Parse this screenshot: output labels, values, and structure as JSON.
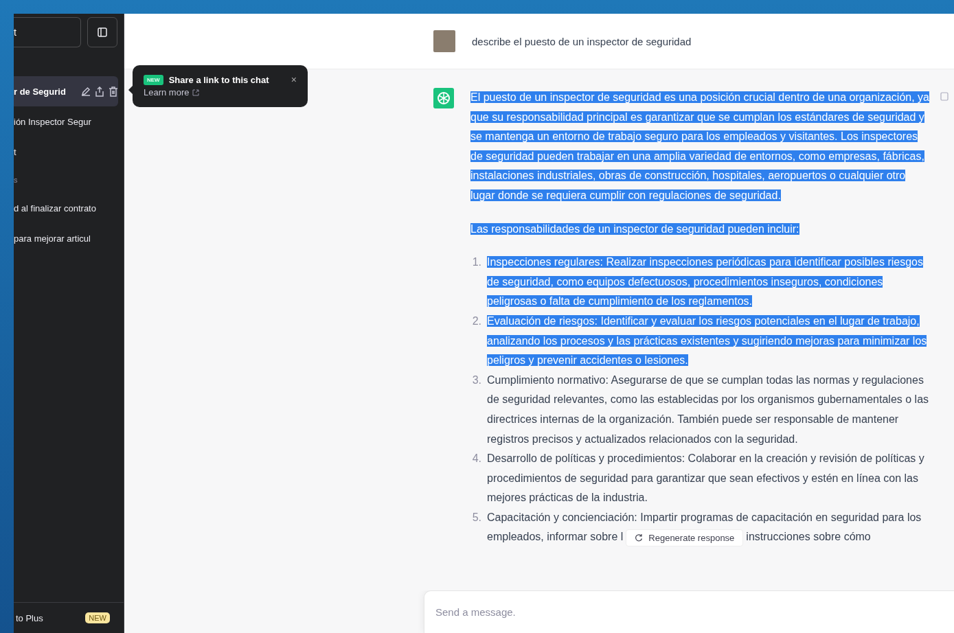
{
  "sidebar": {
    "new_chat_label": "t",
    "chats": [
      {
        "kind": "chat",
        "title": "r de Segurid",
        "selected": true
      },
      {
        "kind": "chat",
        "title": "ión Inspector Segur",
        "selected": false
      },
      {
        "kind": "chat",
        "title": "t",
        "selected": false
      },
      {
        "kind": "heading",
        "title": "s"
      },
      {
        "kind": "chat",
        "title": "d al finalizar contrato",
        "selected": false
      },
      {
        "kind": "chat",
        "title": "para mejorar articul",
        "selected": false
      }
    ],
    "upgrade": {
      "label": "to Plus",
      "badge": "NEW"
    }
  },
  "tooltip": {
    "badge": "NEW",
    "title": "Share a link to this chat",
    "link": "Learn more",
    "close": "×"
  },
  "conversation": {
    "user_message": "describe el puesto de un inspector de seguridad",
    "paragraphs": [
      {
        "text": "El puesto de un inspector de seguridad es una posición crucial dentro de una organización, ya que su responsabilidad principal es garantizar que se cumplan los estándares de seguridad y se mantenga un entorno de trabajo seguro para los empleados y visitantes. Los inspectores de seguridad pueden trabajar en una amplia variedad de entornos, como empresas, fábricas, instalaciones industriales, obras de construcción, hospitales, aeropuertos o cualquier otro lugar donde se requiera cumplir con regulaciones de seguridad.",
        "selected": true
      },
      {
        "text": "Las responsabilidades de un inspector de seguridad pueden incluir:",
        "selected": true
      }
    ],
    "list": [
      {
        "number": "1.",
        "text": "Inspecciones regulares: Realizar inspecciones periódicas para identificar posibles riesgos de seguridad, como equipos defectuosos, procedimientos inseguros, condiciones peligrosas o falta de cumplimiento de los reglamentos.",
        "selected": true
      },
      {
        "number": "2.",
        "text": "Evaluación de riesgos: Identificar y evaluar los riesgos potenciales en el lugar de trabajo, analizando los procesos y las prácticas existentes y sugiriendo mejoras para minimizar los peligros y prevenir accidentes o lesiones.",
        "selected": true
      },
      {
        "number": "3.",
        "text": "Cumplimiento normativo: Asegurarse de que se cumplan todas las normas y regulaciones de seguridad relevantes, como las establecidas por los organismos gubernamentales o las directrices internas de la organización. También puede ser responsable de mantener registros precisos y actualizados relacionados con la seguridad.",
        "selected": false
      },
      {
        "number": "4.",
        "text": "Desarrollo de políticas y procedimientos: Colaborar en la creación y revisión de políticas y procedimientos de seguridad para garantizar que sean efectivos y estén en línea con las mejores prácticas de la industria.",
        "selected": false
      },
      {
        "number": "5.",
        "text": "Capacitación y concienciación: Impartir programas de capacitación en seguridad para los empleados, informar sobre l",
        "text_after": "instrucciones sobre cómo",
        "selected": false
      }
    ]
  },
  "regenerate_button": "Regenerate response",
  "composer": {
    "placeholder": "Send a message."
  }
}
